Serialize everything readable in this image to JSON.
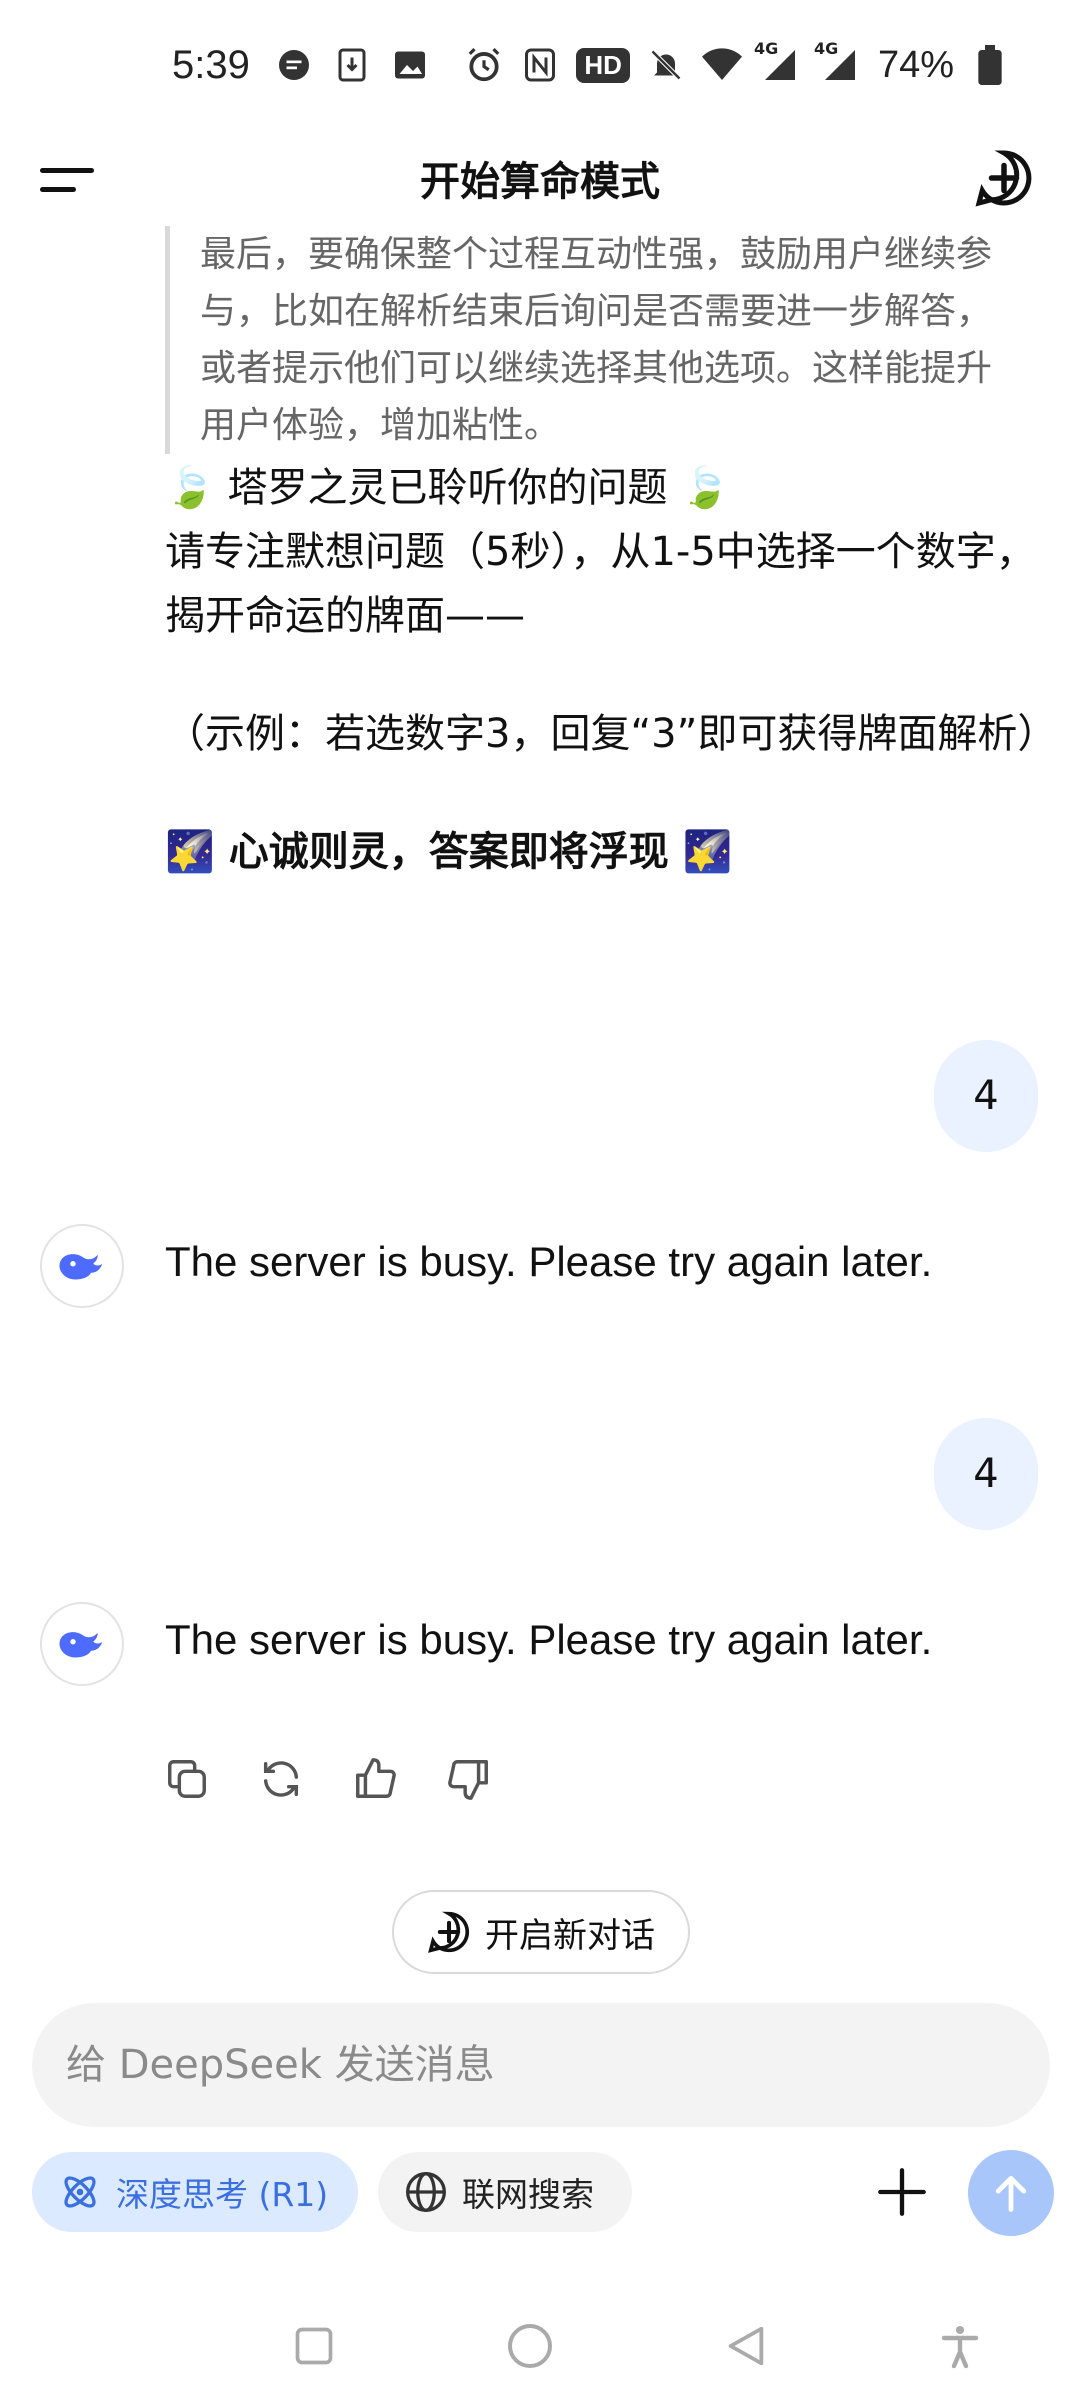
{
  "status_bar": {
    "time": "5:39",
    "hd_label": "HD",
    "battery_percent": "74%",
    "network_labels": [
      "4G",
      "4G"
    ]
  },
  "header": {
    "title": "开始算命模式"
  },
  "chat": {
    "quote_text": "最后，要确保整个过程互动性强，鼓励用户继续参与，比如在解析结束后询问是否需要进一步解答，或者提示他们可以继续选择其他选项。这样能提升用户体验，增加粘性。",
    "intro_line": "🍃 塔罗之灵已聆听你的问题 🍃",
    "prompt_line": "请专注默想问题（5秒），从1-5中选择一个数字，揭开命运的牌面——",
    "example_line": "（示例：若选数字3，回复“3”即可获得牌面解析）",
    "closing_line": "🌠 心诚则灵，答案即将浮现 🌠",
    "messages": [
      {
        "role": "user",
        "text": "4"
      },
      {
        "role": "assistant",
        "text": "The server is busy. Please try again later."
      },
      {
        "role": "user",
        "text": "4"
      },
      {
        "role": "assistant",
        "text": "The server is busy. Please try again later."
      }
    ],
    "new_chat_label": "开启新对话"
  },
  "input": {
    "placeholder": "给 DeepSeek 发送消息"
  },
  "tools": {
    "deep_think_label": "深度思考 (R1)",
    "web_search_label": "联网搜索"
  },
  "colors": {
    "accent": "#4d6bfe",
    "user_bubble": "#eaf1ff",
    "chip_active_bg": "#dbeafe",
    "send_button": "#a8c6fa"
  }
}
